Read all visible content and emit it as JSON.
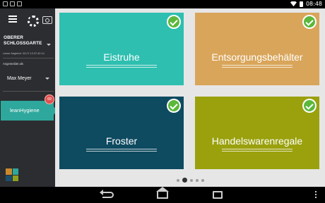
{
  "status_bar": {
    "time": "08:48"
  },
  "sidebar": {
    "location": "OBERER SCHLOSSGARTE",
    "last_sync": "Letzer Abgleich: 03.07.13 07:42:14",
    "logged_in_label": "Angemeldet als",
    "user_name": "Max Meyer",
    "module": {
      "label": "leanHygiene",
      "badge": "69"
    },
    "logo_colors": [
      "#c98a2e",
      "#2ea79c",
      "#1c4f6b",
      "#8f9f1e"
    ]
  },
  "tiles": [
    {
      "label": "Eistruhe",
      "color": "#2ebfb0",
      "checked": true
    },
    {
      "label": "Entsorgungsbehälter",
      "color": "#d9a55a",
      "checked": true
    },
    {
      "label": "Froster",
      "color": "#0e4a60",
      "checked": true
    },
    {
      "label": "Handelswarenregale",
      "color": "#9aa10d",
      "checked": true
    }
  ],
  "pagination": {
    "total": 5,
    "active_index": 1
  }
}
